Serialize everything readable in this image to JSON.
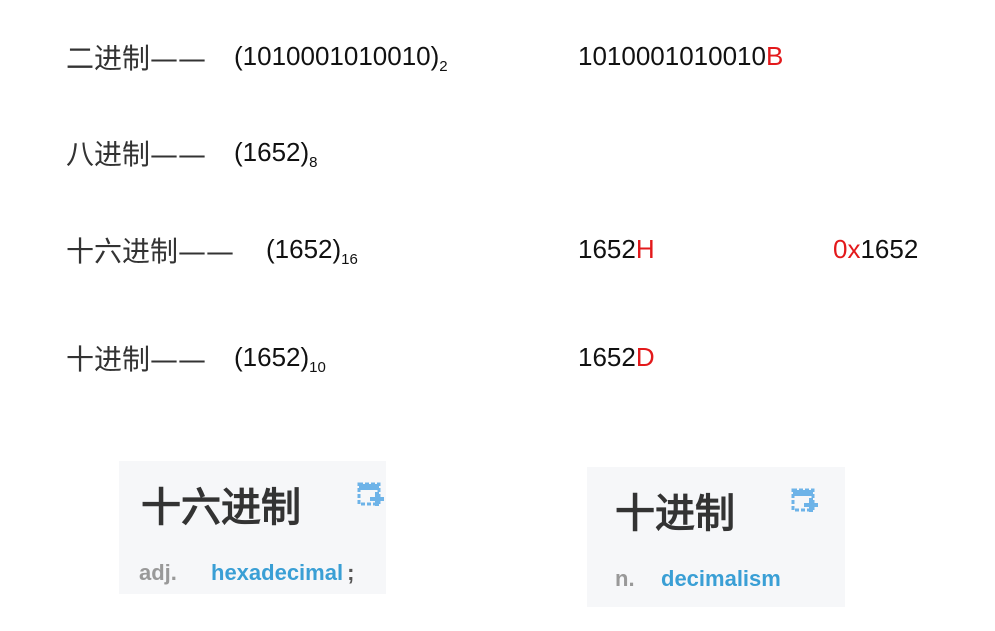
{
  "rows": [
    {
      "label": "二进制——",
      "value_main": "(1010001010010)",
      "value_sub": "2",
      "alt1_main": "1010001010010",
      "alt1_suffix": "B"
    },
    {
      "label": "八进制——",
      "value_main": "(1652)",
      "value_sub": "8"
    },
    {
      "label": "十六进制——",
      "value_main": "(1652)",
      "value_sub": "16",
      "alt1_main": "1652",
      "alt1_suffix": "H",
      "alt2_prefix": "0x",
      "alt2_main": "1652"
    },
    {
      "label": "十进制——",
      "value_main": "(1652)",
      "value_sub": "10",
      "alt1_main": "1652",
      "alt1_suffix": "D"
    }
  ],
  "dict_cards": [
    {
      "word": "十六进制",
      "pos": "adj.",
      "translation": "hexadecimal",
      "trailing": ";"
    },
    {
      "word": "十进制",
      "pos": "n.",
      "translation": "decimalism"
    }
  ],
  "colors": {
    "suffix": "#e3191b",
    "translation": "#3a9fd5",
    "icon": "#6db3e8"
  },
  "icons": [
    "add-to-wordbook-icon"
  ]
}
